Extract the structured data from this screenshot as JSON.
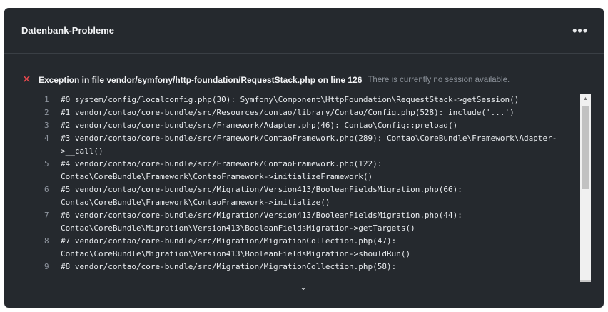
{
  "panel": {
    "title": "Datenbank-Probleme",
    "menu_icon": "more-horizontal-icon",
    "menu_glyph": "•••"
  },
  "error": {
    "icon": "close-icon",
    "icon_glyph": "✕",
    "icon_color": "#e5484d",
    "title": "Exception in file vendor/symfony/http-foundation/RequestStack.php on line 126",
    "message": "There is currently no session available."
  },
  "trace": [
    {
      "n": "1",
      "text": "#0 system/config/localconfig.php(30): Symfony\\Component\\HttpFoundation\\RequestStack->getSession()"
    },
    {
      "n": "2",
      "text": "#1 vendor/contao/core-bundle/src/Resources/contao/library/Contao/Config.php(528): include('...')"
    },
    {
      "n": "3",
      "text": "#2 vendor/contao/core-bundle/src/Framework/Adapter.php(46): Contao\\Config::preload()"
    },
    {
      "n": "4",
      "text": "#3 vendor/contao/core-bundle/src/Framework/ContaoFramework.php(289): Contao\\CoreBundle\\Framework\\Adapter->__call()"
    },
    {
      "n": "5",
      "text": "#4 vendor/contao/core-bundle/src/Framework/ContaoFramework.php(122): Contao\\CoreBundle\\Framework\\ContaoFramework->initializeFramework()"
    },
    {
      "n": "6",
      "text": "#5 vendor/contao/core-bundle/src/Migration/Version413/BooleanFieldsMigration.php(66): Contao\\CoreBundle\\Framework\\ContaoFramework->initialize()"
    },
    {
      "n": "7",
      "text": "#6 vendor/contao/core-bundle/src/Migration/Version413/BooleanFieldsMigration.php(44): Contao\\CoreBundle\\Migration\\Version413\\BooleanFieldsMigration->getTargets()"
    },
    {
      "n": "8",
      "text": "#7 vendor/contao/core-bundle/src/Migration/MigrationCollection.php(47): Contao\\CoreBundle\\Migration\\Version413\\BooleanFieldsMigration->shouldRun()"
    },
    {
      "n": "9",
      "text": "#8 vendor/contao/core-bundle/src/Migration/MigrationCollection.php(58):"
    }
  ],
  "expand": {
    "icon": "chevron-down-icon",
    "glyph": "⌄"
  }
}
